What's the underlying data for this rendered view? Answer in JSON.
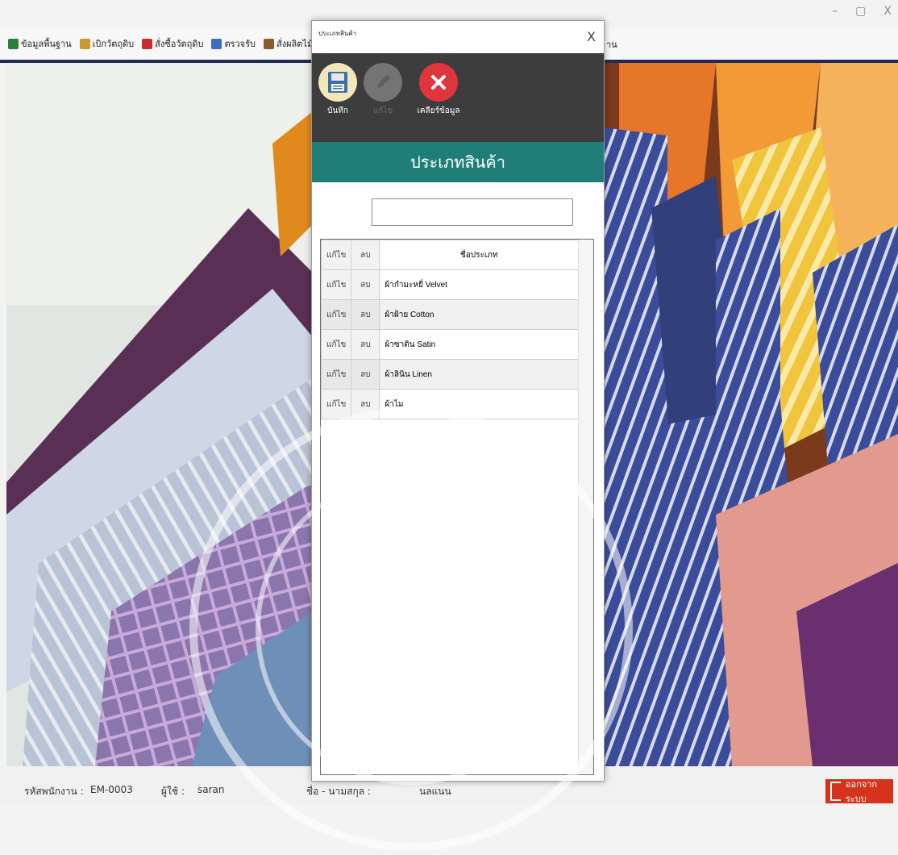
{
  "window": {
    "minimize": "–",
    "maximize": "▢",
    "close": "X"
  },
  "menubar": {
    "items": [
      {
        "label": "ข้อมูลพื้นฐาน",
        "icon": "database-icon",
        "color": "#2d7d3b"
      },
      {
        "label": "เบิกวัตถุดิบ",
        "icon": "box-icon",
        "color": "#c99a2b"
      },
      {
        "label": "สั่งซื้อวัตถุดิบ",
        "icon": "cart-icon",
        "color": "#c72d2d"
      },
      {
        "label": "ตรวจรับ",
        "icon": "document-icon",
        "color": "#3a6fc0"
      },
      {
        "label": "สั่งผลิตไม้ร่มคา",
        "icon": "factory-icon",
        "color": "#8a5a2b"
      }
    ],
    "trail": "าน"
  },
  "status": {
    "emp_label": "รหัสพนักงาน :",
    "emp_value": "EM-0003",
    "user_label": "ผู้ใช้ :",
    "user_value": "saran",
    "name_label": "ชื่อ - นามสกุล :",
    "name_value": "นลแนน",
    "logout": "ออกจากระบบ"
  },
  "dialog": {
    "title": "ประเภทสินค้า",
    "close": "X",
    "toolbar": {
      "save": "บันทึก",
      "edit": "แก้ไข",
      "clear": "เคลียร์ข้อมูล"
    },
    "header": "ประเภทสินค้า",
    "search": {
      "value": "",
      "placeholder": ""
    },
    "table": {
      "headers": {
        "edit": "แก้ไข",
        "delete": "ลบ",
        "name": "ชื่อประเภท"
      },
      "rows": [
        {
          "edit": "แก้ไข",
          "delete": "ลบ",
          "name": "ผ้ากำมะหยี่ Velvet"
        },
        {
          "edit": "แก้ไข",
          "delete": "ลบ",
          "name": "ผ้าฝ้าย Cotton"
        },
        {
          "edit": "แก้ไข",
          "delete": "ลบ",
          "name": "ผ้าซาติน Satin"
        },
        {
          "edit": "แก้ไข",
          "delete": "ลบ",
          "name": "ผ้าลินิน Linen"
        },
        {
          "edit": "แก้ไข",
          "delete": "ลบ",
          "name": "ผ้าไม"
        }
      ]
    }
  }
}
